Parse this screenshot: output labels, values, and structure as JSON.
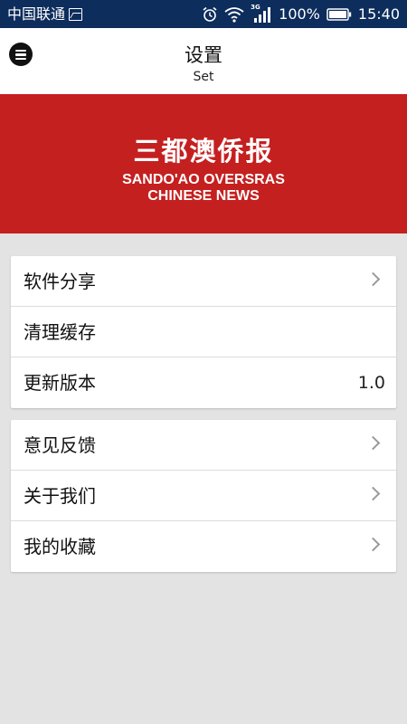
{
  "status_bar": {
    "carrier": "中国联通",
    "network": "3G",
    "battery": "100%",
    "time": "15:40",
    "icons": [
      "image-icon",
      "alarm-icon",
      "wifi-icon",
      "signal-icon",
      "battery-icon"
    ]
  },
  "header": {
    "title": "设置",
    "subtitle": "Set",
    "menu_icon": "menu-icon"
  },
  "banner": {
    "name_cn": "三都澳侨报",
    "name_en_line1": "SANDO'AO OVERSRAS",
    "name_en_line2": "CHINESE NEWS",
    "background": "#c4201f"
  },
  "settings": {
    "group1": [
      {
        "label": "软件分享",
        "icon": "chevron-right-icon"
      },
      {
        "label": "清理缓存"
      },
      {
        "label": "更新版本",
        "value": "1.0"
      }
    ],
    "group2": [
      {
        "label": "意见反馈",
        "icon": "chevron-right-icon"
      },
      {
        "label": "关于我们",
        "icon": "chevron-right-icon"
      },
      {
        "label": "我的收藏",
        "icon": "chevron-right-icon"
      }
    ]
  },
  "colors": {
    "status_bar": "#0d2d5c",
    "page_background": "#e3e3e3",
    "accent_red": "#c4201f"
  }
}
